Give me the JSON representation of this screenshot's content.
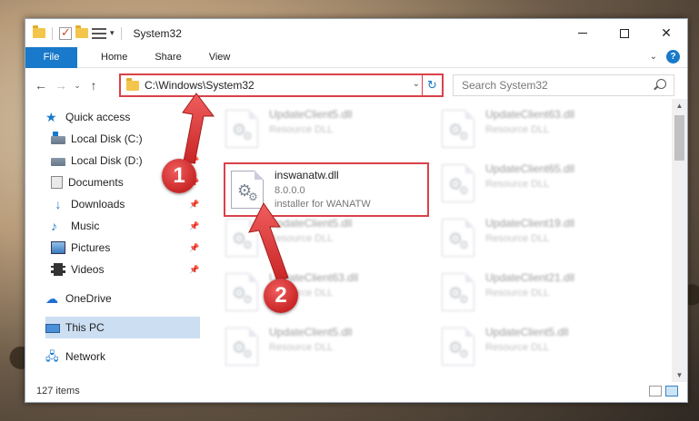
{
  "window": {
    "title": "System32",
    "minimize": "",
    "maximize": "",
    "close": "✕"
  },
  "ribbon": {
    "file_tab": "File",
    "tabs": [
      "Home",
      "Share",
      "View"
    ]
  },
  "navbar": {
    "address": "C:\\Windows\\System32",
    "search_placeholder": "Search System32"
  },
  "sidebar": {
    "items": [
      {
        "label": "Quick access",
        "icon": "star-icon"
      },
      {
        "label": "Local Disk (C:)",
        "icon": "disk-icon",
        "pinned": true
      },
      {
        "label": "Local Disk (D:)",
        "icon": "disk-icon",
        "pinned": true
      },
      {
        "label": "Documents",
        "icon": "documents-icon",
        "pinned": true
      },
      {
        "label": "Downloads",
        "icon": "downloads-icon",
        "pinned": true
      },
      {
        "label": "Music",
        "icon": "music-icon",
        "pinned": true
      },
      {
        "label": "Pictures",
        "icon": "pictures-icon",
        "pinned": true
      },
      {
        "label": "Videos",
        "icon": "videos-icon",
        "pinned": true
      },
      {
        "label": "OneDrive",
        "icon": "cloud-icon"
      },
      {
        "label": "This PC",
        "icon": "pc-icon",
        "selected": true
      },
      {
        "label": "Network",
        "icon": "network-icon"
      }
    ]
  },
  "files": [
    {
      "name": "UpdateClient5.dll",
      "type": "Resource DLL"
    },
    {
      "name": "UpdateClient63.dll",
      "type": "Resource DLL"
    },
    {
      "name": "inswanatw.dll",
      "version": "8.0.0.0",
      "description": "installer for WANATW"
    },
    {
      "name": "UpdateClient65.dll",
      "type": "Resource DLL"
    },
    {
      "name": "UpdateClient5.dll",
      "type": "Resource DLL"
    },
    {
      "name": "UpdateClient19.dll",
      "type": "Resource DLL"
    },
    {
      "name": "UpdateClient63.dll",
      "type": "Resource DLL"
    },
    {
      "name": "UpdateClient21.dll",
      "type": "Resource DLL"
    },
    {
      "name": "UpdateClient5.dll",
      "type": "Resource DLL"
    },
    {
      "name": "UpdateClient5.dll",
      "type": "Resource DLL"
    }
  ],
  "status": {
    "item_count": "127 items"
  },
  "annotations": {
    "marker1": "1",
    "marker2": "2",
    "color": "#d9414a"
  },
  "colors": {
    "accent": "#1979ca",
    "highlight": "#d9414a",
    "selection": "#ccdef2"
  }
}
